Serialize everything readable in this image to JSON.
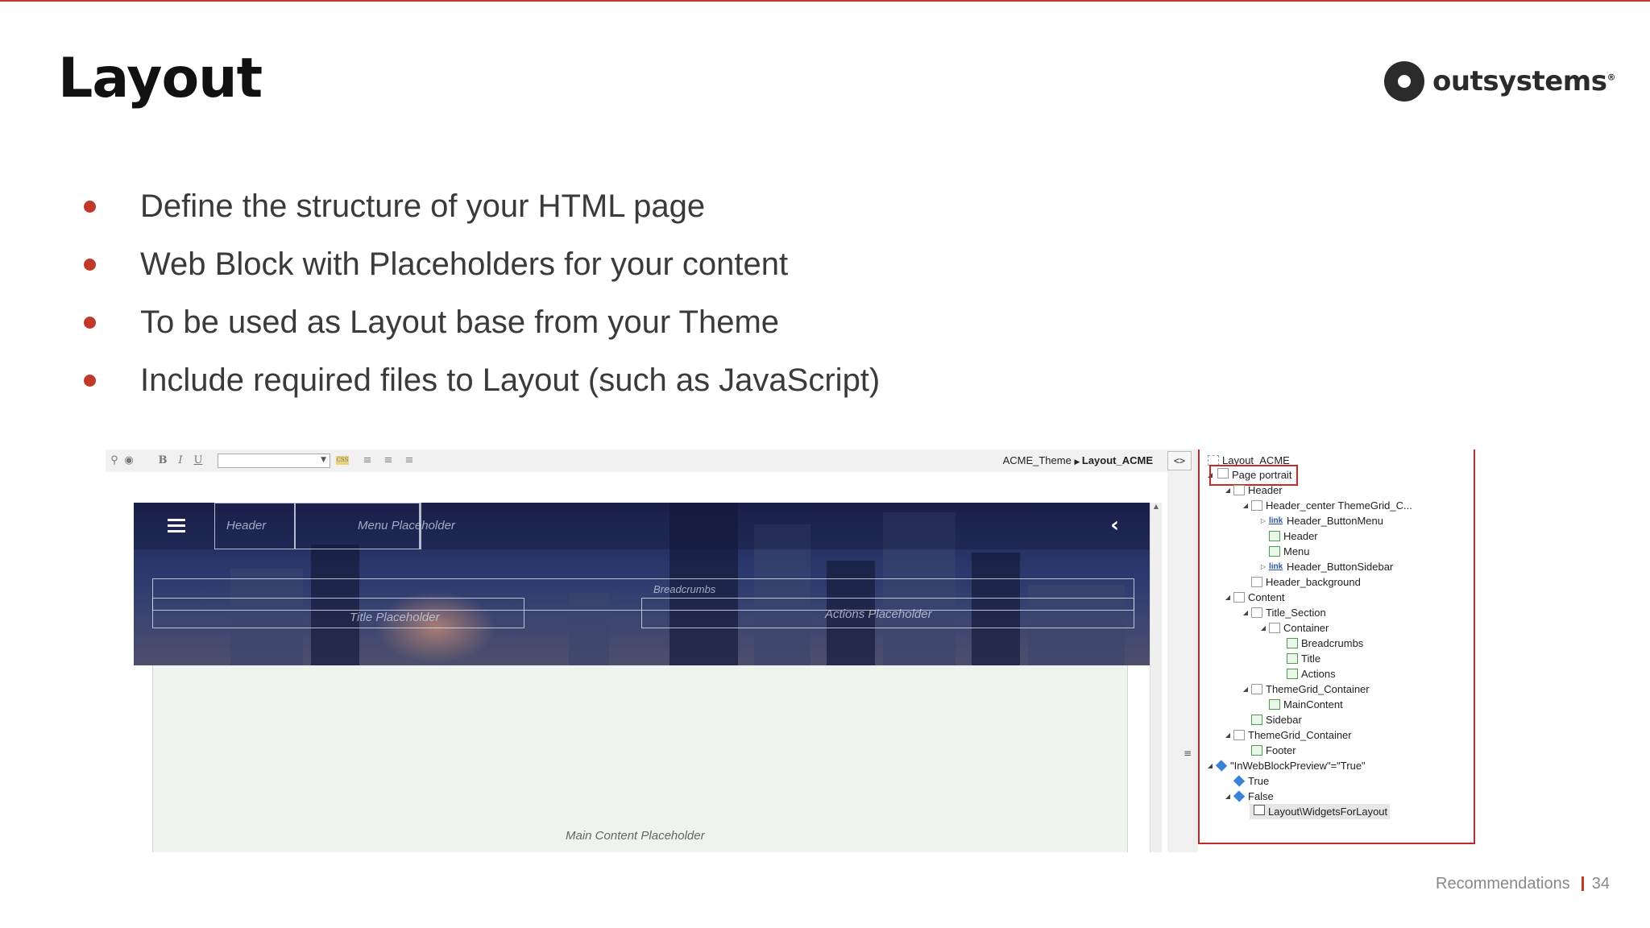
{
  "slide": {
    "title": "Layout",
    "brand": "outsystems",
    "brand_reg": "®",
    "accent_color": "#c0392b",
    "bullets": [
      "Define the structure of your HTML page",
      "Web Block with Placeholders for your content",
      "To be used as Layout base from your Theme",
      "Include required files to Layout (such as JavaScript)"
    ],
    "footer_section": "Recommendations",
    "page_number": "34"
  },
  "editor": {
    "toolbar": {
      "bold": "B",
      "italic": "I",
      "underline": "U",
      "style_select_value": ""
    },
    "breadcrumb": {
      "parent": "ACME_Theme",
      "current": "Layout_ACME"
    },
    "code_toggle": "<>",
    "canvas": {
      "header_label": "Header",
      "menu_label": "Menu Placeholder",
      "title_label": "Title Placeholder",
      "breadcrumbs_label": "Breadcrumbs",
      "actions_label": "Actions Placeholder",
      "main_label": "Main Content Placeholder"
    },
    "tree": {
      "root": "Layout_ACME",
      "nodes": [
        {
          "label": "Page portrait"
        },
        {
          "label": "Header"
        },
        {
          "label": "Header_center ThemeGrid_C..."
        },
        {
          "label": "Header_ButtonMenu"
        },
        {
          "label": "Header"
        },
        {
          "label": "Menu"
        },
        {
          "label": "Header_ButtonSidebar"
        },
        {
          "label": "Header_background"
        },
        {
          "label": "Content"
        },
        {
          "label": "Title_Section"
        },
        {
          "label": "Container"
        },
        {
          "label": "Breadcrumbs"
        },
        {
          "label": "Title"
        },
        {
          "label": "Actions"
        },
        {
          "label": "ThemeGrid_Container"
        },
        {
          "label": "MainContent"
        },
        {
          "label": "Sidebar"
        },
        {
          "label": "ThemeGrid_Container"
        },
        {
          "label": "Footer"
        },
        {
          "label": "\"InWebBlockPreview\"=\"True\""
        },
        {
          "label": "True"
        },
        {
          "label": "False"
        },
        {
          "label": "Layout\\WidgetsForLayout"
        }
      ]
    }
  }
}
